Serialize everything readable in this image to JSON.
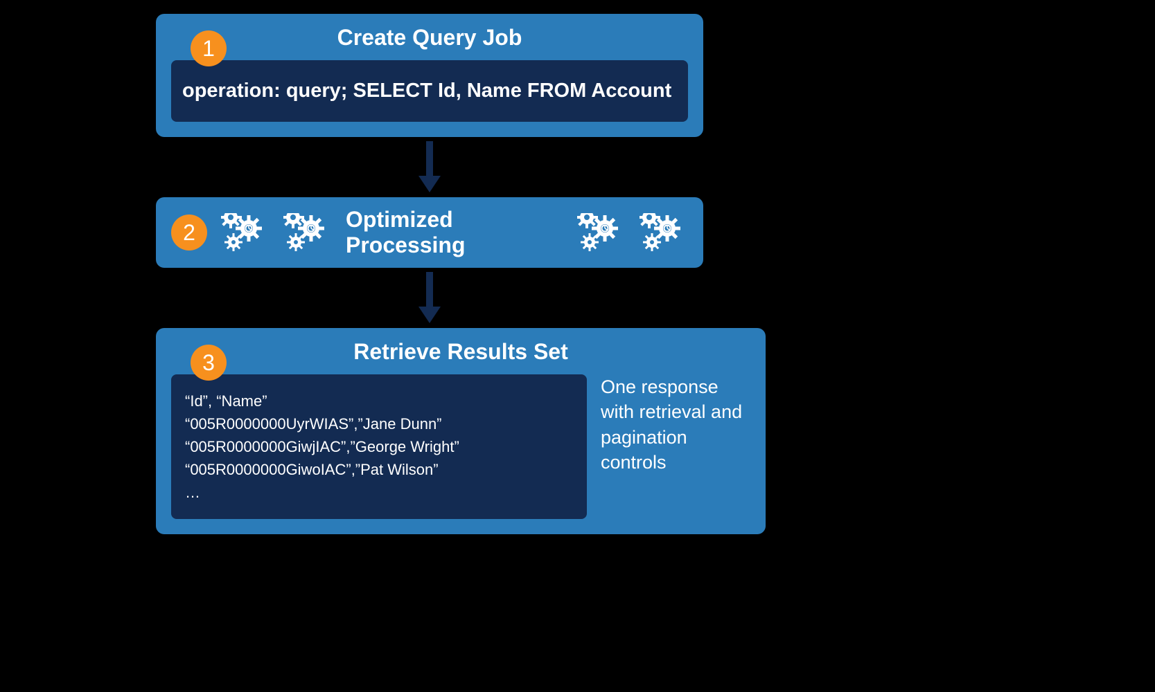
{
  "colors": {
    "panel": "#2b7cb9",
    "codebox": "#132b52",
    "badge": "#f7901e",
    "bg": "#000000",
    "text": "#ffffff"
  },
  "step1": {
    "number": "1",
    "title": "Create Query Job",
    "code": "operation: query; SELECT Id, Name FROM Account"
  },
  "step2": {
    "number": "2",
    "title": "Optimized Processing"
  },
  "step3": {
    "number": "3",
    "title": "Retrieve Results Set",
    "results_text": "“Id”, “Name”\n“005R0000000UyrWIAS”,”Jane Dunn”\n“005R0000000GiwjIAC”,”George Wright”\n“005R0000000GiwoIAC”,”Pat Wilson”\n…",
    "side_note": "One response with retrieval and pagination controls"
  }
}
